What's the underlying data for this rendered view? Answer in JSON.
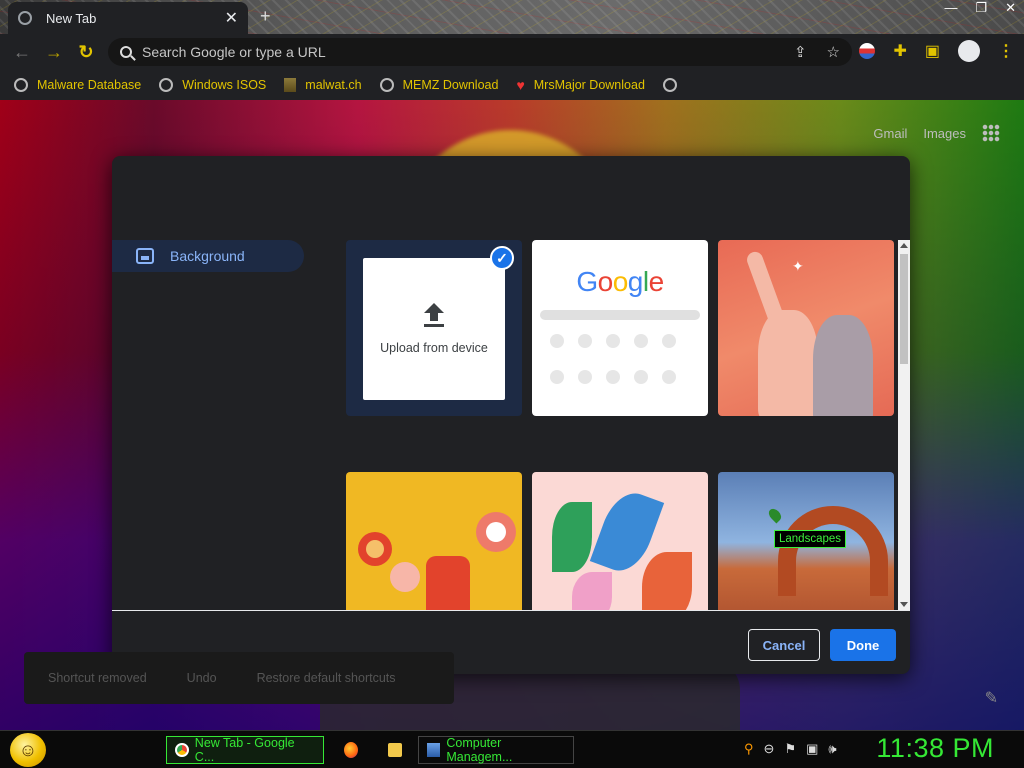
{
  "browser": {
    "tab_title": "New Tab",
    "tab_close": "✕",
    "new_tab": "+",
    "window_controls": [
      "—",
      "❐",
      "✕"
    ],
    "omnibox_placeholder": "Search Google or type a URL",
    "nav": {
      "back": "←",
      "forward": "→",
      "reload": "↻"
    },
    "omnibox_actions": [
      "⇪",
      "☆"
    ]
  },
  "bookmarks": [
    {
      "label": "Malware Database",
      "icon": "globe-icon"
    },
    {
      "label": "Windows ISOS",
      "icon": "globe-icon"
    },
    {
      "label": "malwat.ch",
      "icon": "tower-icon"
    },
    {
      "label": "MEMZ Download",
      "icon": "globe-icon"
    },
    {
      "label": "MrsMajor Download",
      "icon": "heart-icon"
    }
  ],
  "ntp": {
    "links": [
      "Gmail",
      "Images"
    ],
    "toast": {
      "message": "Shortcut removed",
      "undo": "Undo",
      "restore": "Restore default shortcuts"
    }
  },
  "dialog": {
    "nav_item": "Background",
    "upload_label": "Upload from device",
    "google_tile": "Google",
    "tooltip": "Landscapes",
    "cancel": "Cancel",
    "done": "Done"
  },
  "taskbar": {
    "tasks": [
      {
        "label": "New Tab - Google C...",
        "icon": "chrome-icon"
      },
      {
        "label": "Computer Managem...",
        "icon": "computer-management-icon"
      }
    ],
    "clock": "11:38 PM"
  },
  "colors": {
    "accent_blue": "#1a73e8",
    "link_blue": "#8ab4f8",
    "bookmark_yellow": "#e2c400",
    "taskbar_green": "#35e835"
  }
}
